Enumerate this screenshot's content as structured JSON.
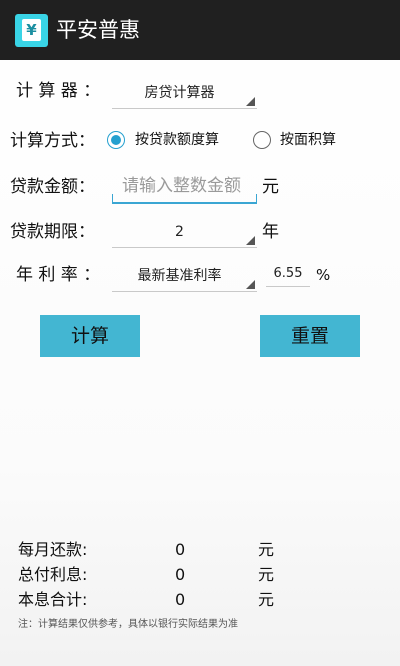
{
  "app": {
    "title": "平安普惠",
    "icon_glyph": "¥"
  },
  "form": {
    "calculator": {
      "label": "计 算 器 ：",
      "selected": "房贷计算器"
    },
    "method": {
      "label": "计算方式：",
      "options": [
        {
          "label": "按贷款额度算",
          "checked": true
        },
        {
          "label": "按面积算",
          "checked": false
        }
      ]
    },
    "amount": {
      "label": "贷款金额：",
      "placeholder": "请输入整数金额",
      "unit": "元"
    },
    "term": {
      "label": "贷款期限：",
      "selected": "2",
      "unit": "年"
    },
    "rate": {
      "label": "年 利 率 ：",
      "selected": "最新基准利率",
      "value": "6.55",
      "unit": "%"
    }
  },
  "buttons": {
    "calculate": "计算",
    "reset": "重置"
  },
  "results": [
    {
      "label": "每月还款:",
      "value": "0",
      "unit": "元"
    },
    {
      "label": "总付利息:",
      "value": "0",
      "unit": "元"
    },
    {
      "label": "本息合计:",
      "value": "0",
      "unit": "元"
    }
  ],
  "note": "注：计算结果仅供参考，具体以银行实际结果为准",
  "colors": {
    "titlebar": "#202020",
    "accent": "#43b6d2",
    "radio": "#24a0cf",
    "icon_bg": "#39d4e6"
  }
}
